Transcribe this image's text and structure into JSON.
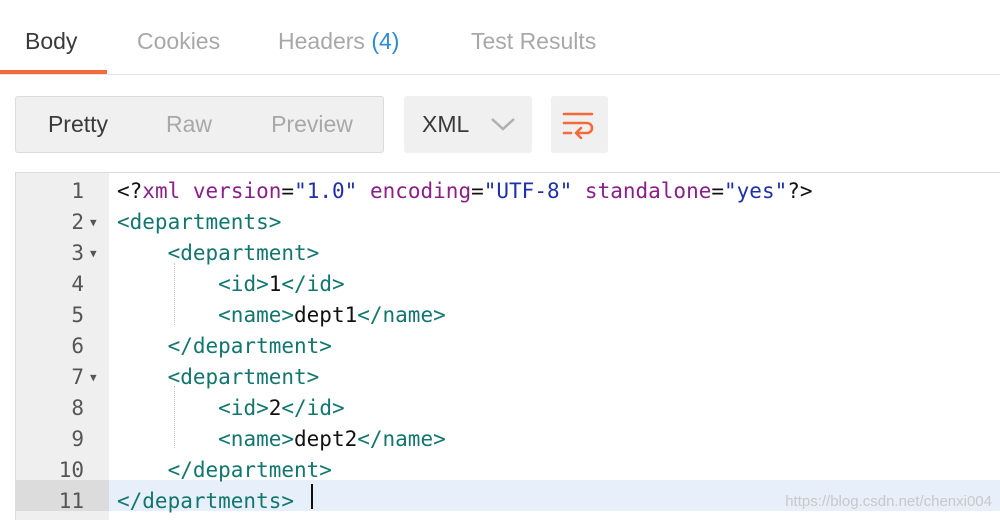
{
  "tabs": [
    {
      "label": "Body"
    },
    {
      "label": "Cookies"
    },
    {
      "label": "Headers",
      "count": "(4)"
    },
    {
      "label": "Test Results"
    }
  ],
  "view_modes": {
    "pretty": "Pretty",
    "raw": "Raw",
    "preview": "Preview",
    "selected": "Pretty"
  },
  "format_select": {
    "value": "XML"
  },
  "icons": {
    "format_dropdown": "chevron-down-icon",
    "wrap": "wrap-lines-icon"
  },
  "colors": {
    "accent": "#f26b3a",
    "count": "#2f8ad6",
    "tag": "#12766f",
    "attribute": "#8a1f8a",
    "string": "#1f2fa8"
  },
  "editor": {
    "active_line": 11,
    "lines": [
      {
        "n": "1",
        "parts": [
          {
            "t": "<?",
            "c": "txt"
          },
          {
            "t": "xml",
            "c": "attr"
          },
          {
            "t": " ",
            "c": "txt"
          },
          {
            "t": "version",
            "c": "attr"
          },
          {
            "t": "=",
            "c": "txt"
          },
          {
            "t": "\"1.0\"",
            "c": "str"
          },
          {
            "t": " ",
            "c": "txt"
          },
          {
            "t": "encoding",
            "c": "attr"
          },
          {
            "t": "=",
            "c": "txt"
          },
          {
            "t": "\"UTF-8\"",
            "c": "str"
          },
          {
            "t": " ",
            "c": "txt"
          },
          {
            "t": "standalone",
            "c": "attr"
          },
          {
            "t": "=",
            "c": "txt"
          },
          {
            "t": "\"yes\"",
            "c": "str"
          },
          {
            "t": "?>",
            "c": "txt"
          }
        ]
      },
      {
        "n": "2",
        "fold": true,
        "parts": [
          {
            "t": "<departments>",
            "c": "tag"
          }
        ]
      },
      {
        "n": "3",
        "fold": true,
        "parts": [
          {
            "t": "    ",
            "c": "txt"
          },
          {
            "t": "<department>",
            "c": "tag"
          }
        ]
      },
      {
        "n": "4",
        "parts": [
          {
            "t": "        ",
            "c": "txt"
          },
          {
            "t": "<id>",
            "c": "tag"
          },
          {
            "t": "1",
            "c": "txt"
          },
          {
            "t": "</id>",
            "c": "tag"
          }
        ]
      },
      {
        "n": "5",
        "parts": [
          {
            "t": "        ",
            "c": "txt"
          },
          {
            "t": "<name>",
            "c": "tag"
          },
          {
            "t": "dept1",
            "c": "txt"
          },
          {
            "t": "</name>",
            "c": "tag"
          }
        ]
      },
      {
        "n": "6",
        "parts": [
          {
            "t": "    ",
            "c": "txt"
          },
          {
            "t": "</department>",
            "c": "tag"
          }
        ]
      },
      {
        "n": "7",
        "fold": true,
        "parts": [
          {
            "t": "    ",
            "c": "txt"
          },
          {
            "t": "<department>",
            "c": "tag"
          }
        ]
      },
      {
        "n": "8",
        "parts": [
          {
            "t": "        ",
            "c": "txt"
          },
          {
            "t": "<id>",
            "c": "tag"
          },
          {
            "t": "2",
            "c": "txt"
          },
          {
            "t": "</id>",
            "c": "tag"
          }
        ]
      },
      {
        "n": "9",
        "parts": [
          {
            "t": "        ",
            "c": "txt"
          },
          {
            "t": "<name>",
            "c": "tag"
          },
          {
            "t": "dept2",
            "c": "txt"
          },
          {
            "t": "</name>",
            "c": "tag"
          }
        ]
      },
      {
        "n": "10",
        "parts": [
          {
            "t": "    ",
            "c": "txt"
          },
          {
            "t": "</department>",
            "c": "tag"
          }
        ]
      },
      {
        "n": "11",
        "parts": [
          {
            "t": "</departments>",
            "c": "tag"
          }
        ]
      }
    ]
  },
  "watermark": "https://blog.csdn.net/chenxi004"
}
